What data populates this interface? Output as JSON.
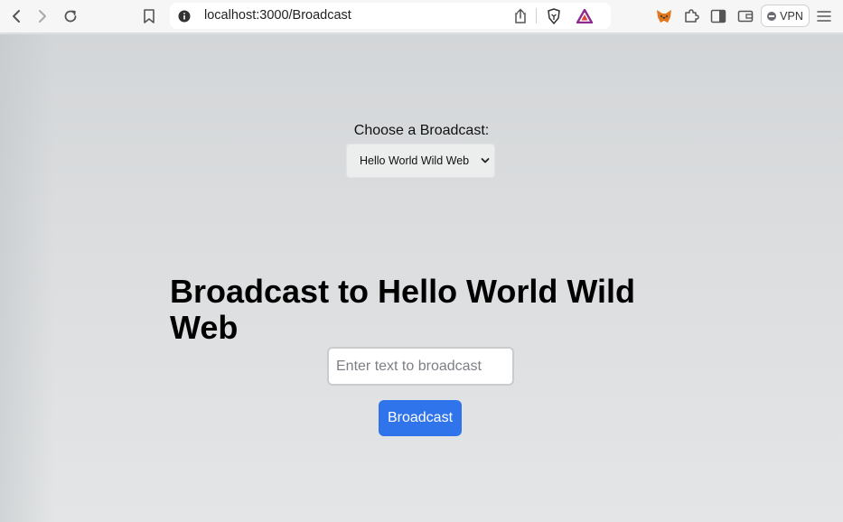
{
  "browser": {
    "url": "localhost:3000/Broadcast",
    "vpn_label": "VPN",
    "icons": {
      "back": "chevron-left-icon",
      "forward": "chevron-right-icon",
      "reload": "reload-icon",
      "bookmark": "bookmark-icon",
      "site_info": "info-icon",
      "share": "share-icon",
      "brave_shields": "lion-shield-icon",
      "brave_rewards": "triangle-icon",
      "metamask": "fox-icon",
      "extensions": "puzzle-icon",
      "sidebar": "sidebar-icon",
      "wallet": "wallet-icon",
      "menu": "hamburger-icon"
    },
    "accent": "#2f74eb"
  },
  "page": {
    "choose_label": "Choose a Broadcast:",
    "select": {
      "selected": "Hello World Wild Web"
    },
    "heading": "Broadcast to Hello World Wild Web",
    "input": {
      "value": "",
      "placeholder": "Enter text to broadcast"
    },
    "button_label": "Broadcast"
  }
}
